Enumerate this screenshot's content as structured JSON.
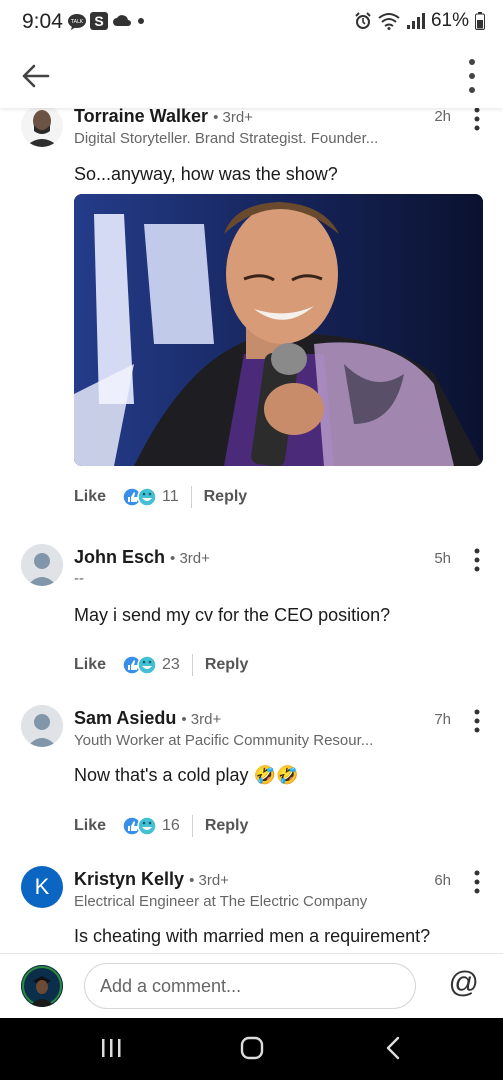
{
  "status": {
    "time": "9:04",
    "battery": "61%",
    "talk_badge": "TALK",
    "s_badge": "S"
  },
  "comments": [
    {
      "name": "Torraine Walker",
      "degree": "• 3rd+",
      "headline": "Digital Storyteller. Brand Strategist. Founder...",
      "time": "2h",
      "text": "So...anyway, how was the show?",
      "like": "Like",
      "reactions": "11",
      "reply": "Reply"
    },
    {
      "name": "John Esch",
      "degree": "• 3rd+",
      "headline": "--",
      "time": "5h",
      "text": "May i send my cv for the CEO position?",
      "like": "Like",
      "reactions": "23",
      "reply": "Reply"
    },
    {
      "name": "Sam Asiedu",
      "degree": "• 3rd+",
      "headline": "Youth Worker at Pacific Community Resour...",
      "time": "7h",
      "text": "Now that's a cold play 🤣🤣",
      "like": "Like",
      "reactions": "16",
      "reply": "Reply"
    },
    {
      "name": "Kristyn Kelly",
      "degree": "• 3rd+",
      "headline": "Electrical Engineer at The Electric Company",
      "time": "6h",
      "text": "Is cheating with married men a requirement?",
      "avatar_letter": "K"
    }
  ],
  "composer": {
    "placeholder": "Add a comment...",
    "at_symbol": "@"
  },
  "colors": {
    "brand": "#0a66c2",
    "like_blue": "#378fe9",
    "laugh_teal": "#44bfd3"
  }
}
